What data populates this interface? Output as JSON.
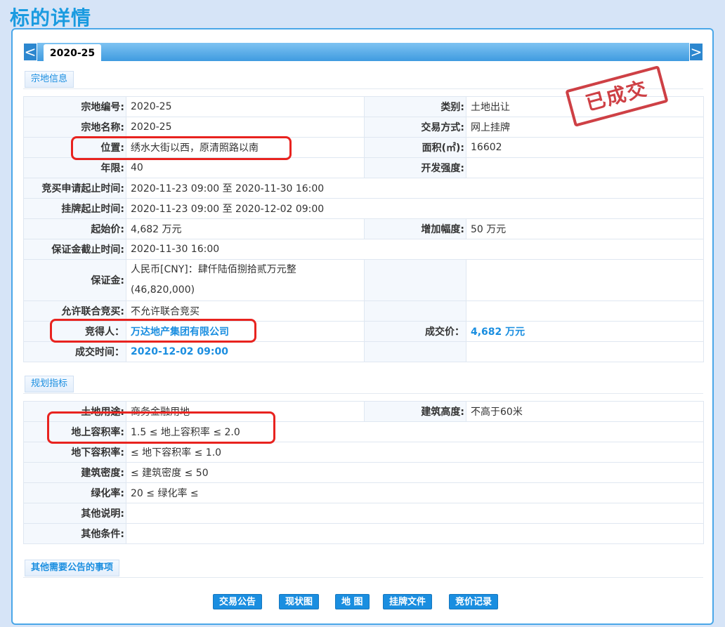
{
  "page": {
    "title": "标的详情"
  },
  "tab": {
    "prev": "<",
    "active": "2020-25",
    "next": ">"
  },
  "stamp": {
    "text": "已成交"
  },
  "section_parcel": {
    "label": "宗地信息"
  },
  "section_plan": {
    "label": "规划指标"
  },
  "section_other": {
    "label": "其他需要公告的事项"
  },
  "parcel": {
    "code_label": "宗地编号:",
    "code": "2020-25",
    "category_label": "类别:",
    "category": "土地出让",
    "name_label": "宗地名称:",
    "name": "2020-25",
    "trade_mode_label": "交易方式:",
    "trade_mode": "网上挂牌",
    "location_label": "位置:",
    "location": "绣水大街以西，原清照路以南",
    "area_label": "面积(㎡):",
    "area": "16602",
    "term_label": "年限:",
    "term": "40",
    "dev_intensity_label": "开发强度:",
    "dev_intensity": "",
    "apply_period_label": "竞买申请起止时间:",
    "apply_period": "2020-11-23 09:00 至 2020-11-30 16:00",
    "listing_period_label": "挂牌起止时间:",
    "listing_period": "2020-11-23 09:00 至 2020-12-02 09:00",
    "start_price_label": "起始价:",
    "start_price": "4,682 万元",
    "increment_label": "增加幅度:",
    "increment": "50 万元",
    "deposit_deadline_label": "保证金截止时间:",
    "deposit_deadline": "2020-11-30 16:00",
    "deposit_label": "保证金:",
    "deposit_line1": "人民币[CNY]：肆仟陆佰捌拾贰万元整",
    "deposit_line2": "(46,820,000)",
    "joint_bid_label": "允许联合竞买:",
    "joint_bid": "不允许联合竞买",
    "winner_label": "竞得人：",
    "winner": "万达地产集团有限公司",
    "deal_price_label": "成交价：",
    "deal_price": "4,682 万元",
    "deal_time_label": "成交时间：",
    "deal_time": "2020-12-02 09:00"
  },
  "plan": {
    "land_use_label": "土地用途:",
    "land_use": "商务金融用地",
    "height_label": "建筑高度:",
    "height": "不高于60米",
    "far_above_label": "地上容积率:",
    "far_above": "1.5 ≤ 地上容积率 ≤ 2.0",
    "far_below_label": "地下容积率:",
    "far_below": "≤ 地下容积率 ≤ 1.0",
    "density_label": "建筑密度:",
    "density": "≤ 建筑密度 ≤ 50",
    "green_label": "绿化率:",
    "green": "20 ≤ 绿化率 ≤",
    "other_note_label": "其他说明:",
    "other_note": "",
    "other_cond_label": "其他条件:",
    "other_cond": ""
  },
  "buttons": {
    "trade_notice": "交易公告",
    "status_map": "现状图",
    "map": "地 图",
    "listing_docs": "挂牌文件",
    "bid_record": "竞价记录"
  },
  "colors": {
    "accent": "#1a8ee0",
    "stamp": "#c8262c",
    "annotation": "#e8231f"
  }
}
